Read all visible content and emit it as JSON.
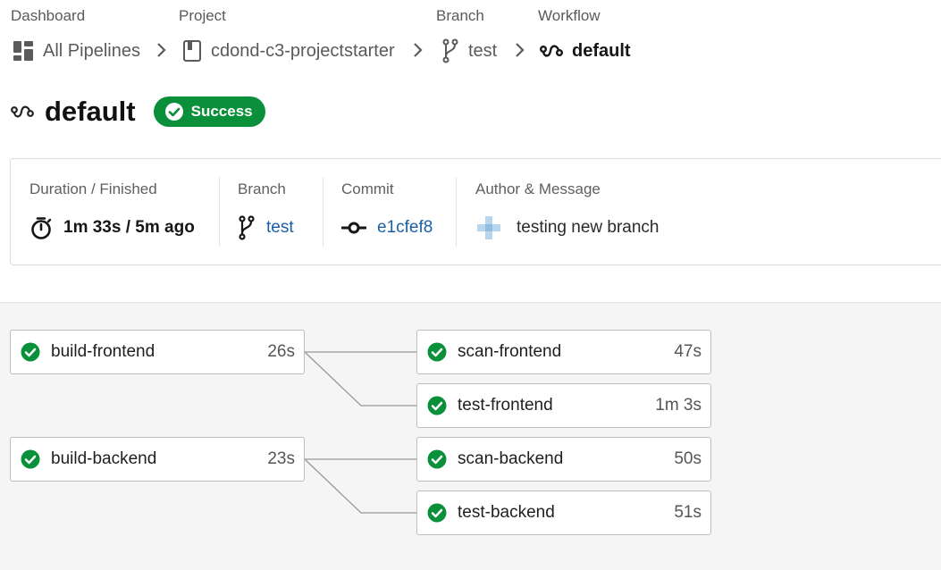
{
  "breadcrumb": {
    "captions": {
      "dashboard": "Dashboard",
      "project": "Project",
      "branch": "Branch",
      "workflow": "Workflow"
    },
    "items": {
      "pipelines": "All Pipelines",
      "project": "cdond-c3-projectstarter",
      "branch": "test",
      "workflow": "default"
    }
  },
  "header": {
    "title": "default",
    "status": "Success",
    "status_color": "#0a8f3a"
  },
  "info": {
    "duration_caption": "Duration / Finished",
    "duration_value": "1m 33s / 5m ago",
    "branch_caption": "Branch",
    "branch_value": "test",
    "commit_caption": "Commit",
    "commit_value": "e1cfef8",
    "author_caption": "Author & Message",
    "message": "testing new branch"
  },
  "jobs": {
    "build_frontend": {
      "name": "build-frontend",
      "duration": "26s",
      "status": "success"
    },
    "scan_frontend": {
      "name": "scan-frontend",
      "duration": "47s",
      "status": "success"
    },
    "test_frontend": {
      "name": "test-frontend",
      "duration": "1m 3s",
      "status": "success"
    },
    "build_backend": {
      "name": "build-backend",
      "duration": "23s",
      "status": "success"
    },
    "scan_backend": {
      "name": "scan-backend",
      "duration": "50s",
      "status": "success"
    },
    "test_backend": {
      "name": "test-backend",
      "duration": "51s",
      "status": "success"
    }
  },
  "colors": {
    "success": "#0a8f3a",
    "link": "#1a5fa6"
  }
}
